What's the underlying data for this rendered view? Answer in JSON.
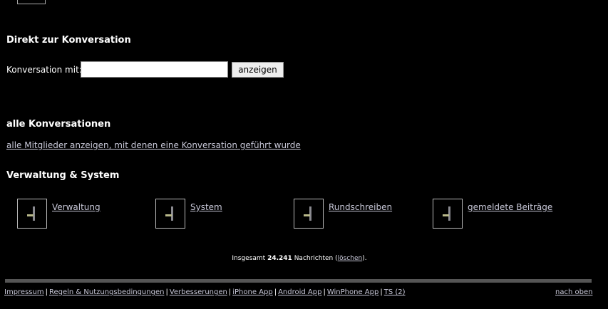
{
  "sections": {
    "direkt_title": "Direkt zur Konversation",
    "alle_title": "alle Konversationen",
    "verwaltung_title": "Verwaltung & System"
  },
  "conversation": {
    "label": "Konversation mit:",
    "input_value": "",
    "button_label": "anzeigen"
  },
  "all_members_link": "alle Mitglieder anzeigen, mit denen eine Konversation geführt wurde",
  "admin_items": [
    {
      "label": "Verwaltung",
      "icon": "admin-icon"
    },
    {
      "label": "System",
      "icon": "admin-icon"
    },
    {
      "label": "Rundschreiben",
      "icon": "admin-icon"
    },
    {
      "label": "gemeldete Beiträge",
      "icon": "admin-icon"
    }
  ],
  "summary": {
    "prefix": "Insgesamt",
    "count": "24.241",
    "middle": "Nachrichten (",
    "delete_link": "löschen",
    "suffix": ")."
  },
  "footer": {
    "links": [
      "Impressum",
      "Regeln & Nutzungsbedingungen",
      "Verbesserungen",
      "iPhone App",
      "Android App",
      "WinPhone App",
      "TS (2)"
    ],
    "back_to_top": "nach oben"
  },
  "colors": {
    "background": "#000000",
    "text": "#ffffff",
    "link": "#c8c8d8",
    "divider": "#555555"
  }
}
